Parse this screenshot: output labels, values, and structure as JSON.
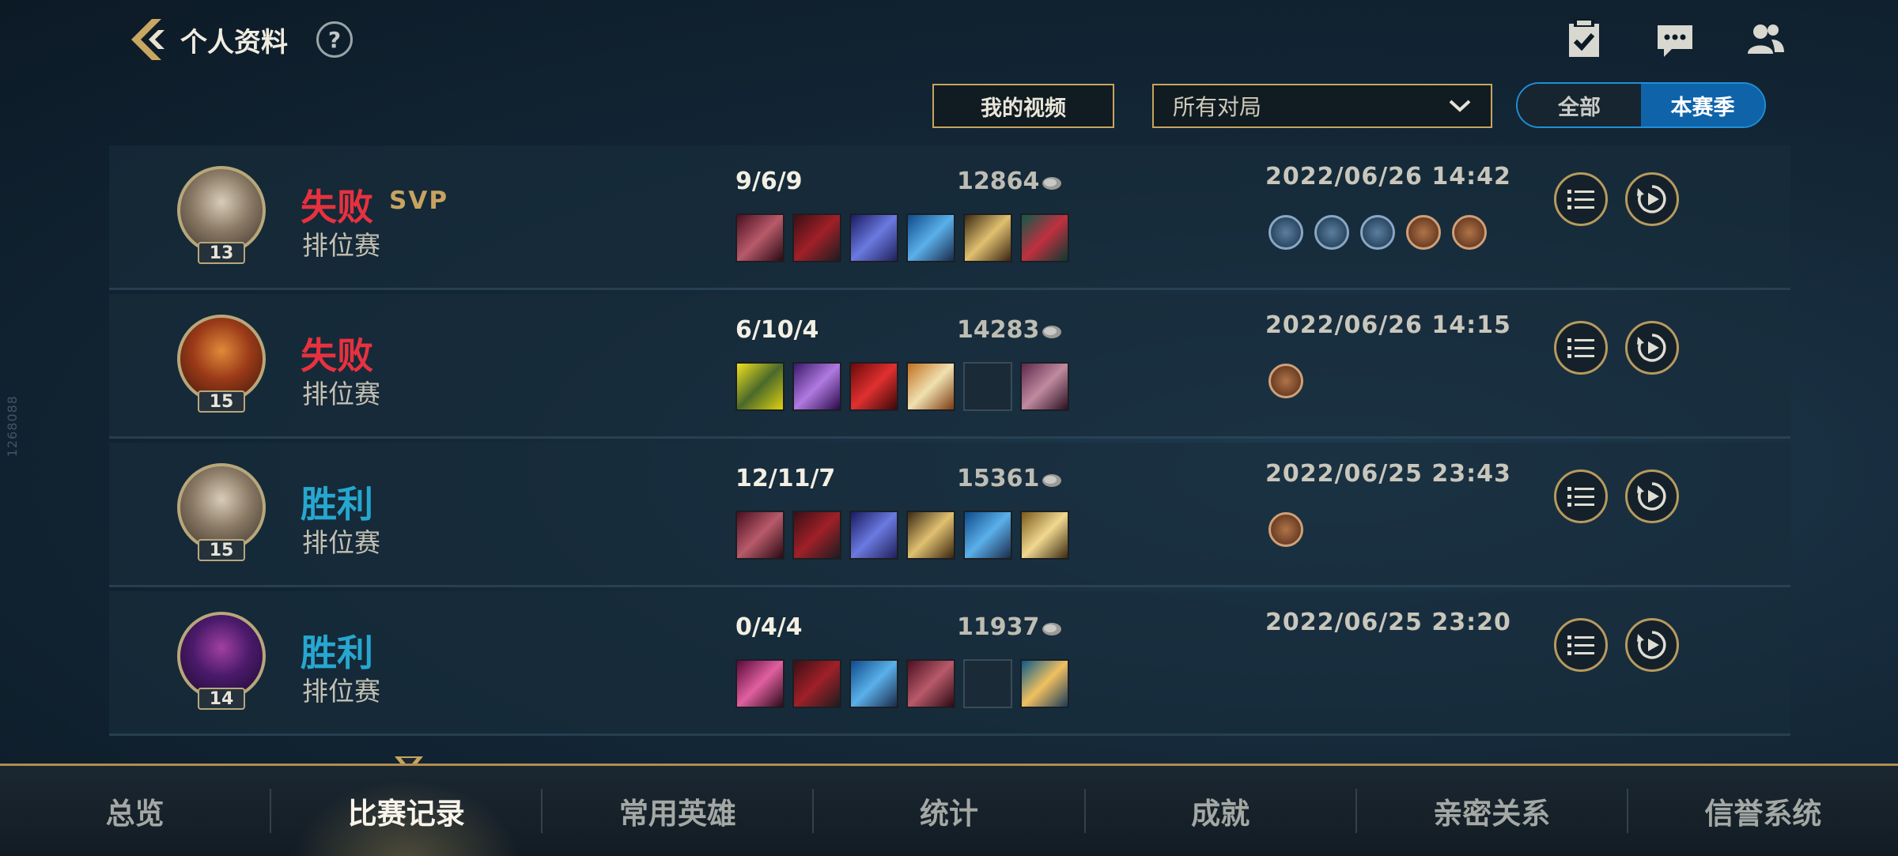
{
  "header": {
    "title": "个人资料",
    "help": "?"
  },
  "toolbar": {
    "my_videos": "我的视频",
    "match_filter": "所有对局",
    "season_toggle": {
      "all": "全部",
      "current": "本赛季"
    }
  },
  "watermark": "1268088",
  "matches": [
    {
      "result": "失败",
      "tag": "SVP",
      "mode": "排位赛",
      "level": "13",
      "kda": "9/6/9",
      "gold": "12864",
      "datetime": "2022/06/26 14:42"
    },
    {
      "result": "失败",
      "tag": "",
      "mode": "排位赛",
      "level": "15",
      "kda": "6/10/4",
      "gold": "14283",
      "datetime": "2022/06/26 14:15"
    },
    {
      "result": "胜利",
      "tag": "",
      "mode": "排位赛",
      "level": "15",
      "kda": "12/11/7",
      "gold": "15361",
      "datetime": "2022/06/25 23:43"
    },
    {
      "result": "胜利",
      "tag": "",
      "mode": "排位赛",
      "level": "14",
      "kda": "0/4/4",
      "gold": "11937",
      "datetime": "2022/06/25 23:20"
    }
  ],
  "nav": {
    "tabs": [
      "总览",
      "比赛记录",
      "常用英雄",
      "统计",
      "成就",
      "亲密关系",
      "信誉系统"
    ],
    "active": "比赛记录"
  },
  "colors": {
    "lose": "#e8313f",
    "win": "#26a7d0",
    "gold_border": "#c8a55c",
    "accent_blue": "#0f64a9"
  }
}
